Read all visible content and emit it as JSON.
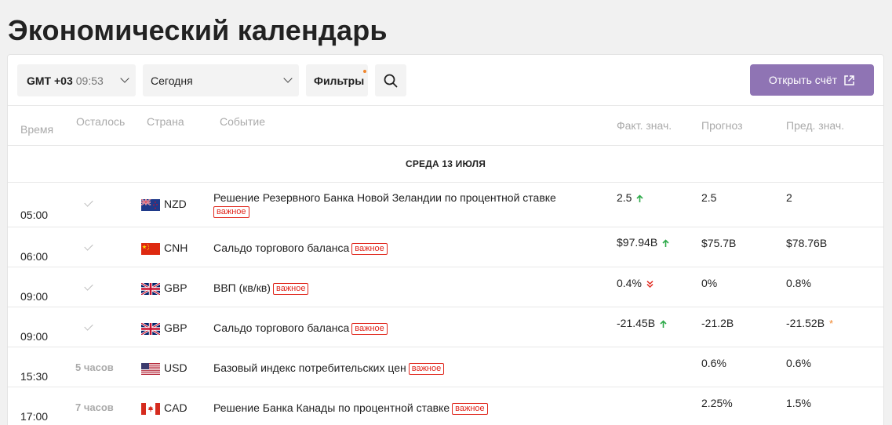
{
  "page": {
    "title": "Экономический календарь"
  },
  "toolbar": {
    "timezone_label": "GMT +03",
    "timezone_time": "09:53",
    "date_value": "Сегодня",
    "filters_label": "Фильтры",
    "open_account_label": "Открыть счёт"
  },
  "table": {
    "headers": {
      "time": "Время",
      "remaining": "Осталось",
      "country": "Страна",
      "event": "Событие",
      "actual": "Факт. знач.",
      "forecast": "Прогноз",
      "previous": "Пред. знач."
    },
    "day": "СРЕДА 13 ИЮЛЯ",
    "important_badge": "важное",
    "rows": [
      {
        "time": "05:00",
        "remaining": "",
        "currency": "NZD",
        "flag": "nz-flag-icon",
        "event": "Решение Резервного Банка Новой Зеландии по процентной ставке",
        "actual": "2.5",
        "actual_trend": "up",
        "forecast": "2.5",
        "previous": "2"
      },
      {
        "time": "06:00",
        "remaining": "",
        "currency": "CNH",
        "flag": "cn-flag-icon",
        "event": "Сальдо торгового баланса",
        "actual": "$97.94B",
        "actual_trend": "up",
        "forecast": "$75.7B",
        "previous": "$78.76B"
      },
      {
        "time": "09:00",
        "remaining": "",
        "currency": "GBP",
        "flag": "gb-flag-icon",
        "event": "ВВП (кв/кв)",
        "actual": "0.4%",
        "actual_trend": "down",
        "forecast": "0%",
        "previous": "0.8%"
      },
      {
        "time": "09:00",
        "remaining": "",
        "currency": "GBP",
        "flag": "gb-flag-icon",
        "event": "Сальдо торгового баланса",
        "actual": "-21.45B",
        "actual_trend": "up",
        "forecast": "-21.2B",
        "previous": "-21.52B",
        "previous_revised": "*"
      },
      {
        "time": "15:30",
        "remaining": "5 часов",
        "currency": "USD",
        "flag": "us-flag-icon",
        "event": "Базовый индекс потребительских цен",
        "actual": "",
        "forecast": "0.6%",
        "previous": "0.6%"
      },
      {
        "time": "17:00",
        "remaining": "7 часов",
        "currency": "CAD",
        "flag": "ca-flag-icon",
        "event": "Решение Банка Канады по процентной ставке",
        "actual": "",
        "forecast": "2.25%",
        "previous": "1.5%"
      }
    ]
  },
  "colors": {
    "accent": "#8f74b4",
    "badge": "#e0261c",
    "up": "#2eaa4a",
    "down": "#e0261c",
    "dot": "#f0862e"
  }
}
